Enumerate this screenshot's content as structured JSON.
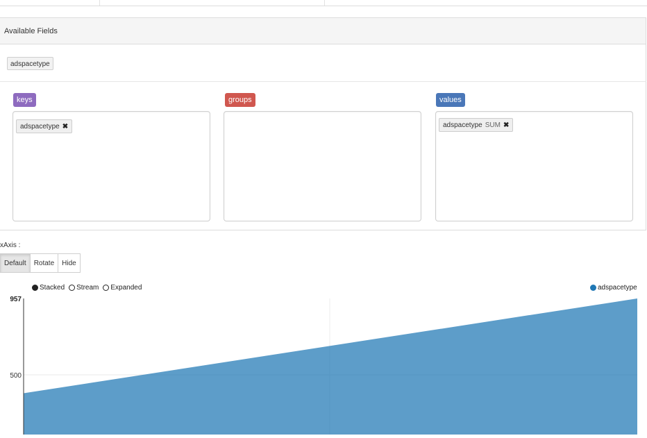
{
  "available_fields": {
    "title": "Available Fields",
    "fields": [
      "adspacetype"
    ]
  },
  "zones": {
    "keys": {
      "label": "keys",
      "items": [
        {
          "name": "adspacetype",
          "remove": "✖"
        }
      ]
    },
    "groups": {
      "label": "groups",
      "items": []
    },
    "values": {
      "label": "values",
      "items": [
        {
          "name": "adspacetype",
          "aggregate": "SUM",
          "remove": "✖"
        }
      ]
    }
  },
  "axis": {
    "title": "xAxis :",
    "buttons": [
      "Default",
      "Rotate",
      "Hide"
    ],
    "active": "Default"
  },
  "chart_controls": {
    "options": [
      "Stacked",
      "Stream",
      "Expanded"
    ],
    "selected": "Stacked"
  },
  "colors": {
    "series": "#1f77b4",
    "keys": "#8e6bbf",
    "groups": "#d0574f",
    "values": "#4a77b8"
  },
  "chart_data": {
    "type": "area",
    "series": [
      {
        "name": "adspacetype",
        "values": [
          390,
          957
        ]
      }
    ],
    "y_ticks": [
      "500",
      "957"
    ],
    "ylim": [
      290,
      957
    ],
    "legend": "top-right",
    "grid": true
  }
}
